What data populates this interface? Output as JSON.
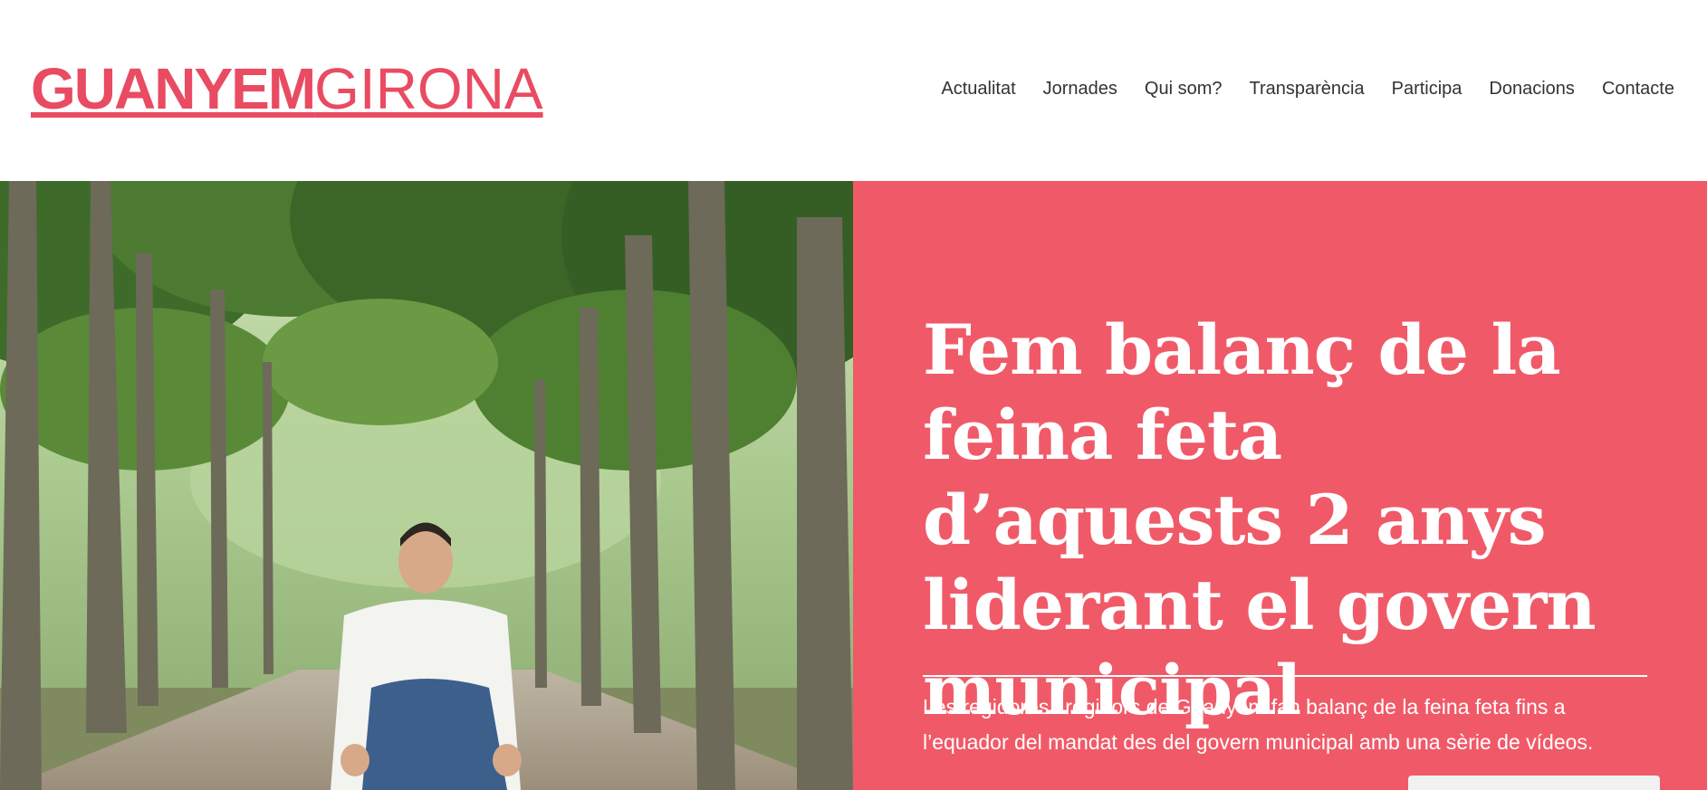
{
  "header": {
    "logo_bold": "GUANYEM",
    "logo_light": "GIRONA",
    "nav": [
      "Actualitat",
      "Jornades",
      "Qui som?",
      "Transparència",
      "Participa",
      "Donacions",
      "Contacte"
    ]
  },
  "hero": {
    "headline": "Fem balanç de la feina feta d’aquests 2 anys liderant el govern municipal",
    "subtitle": "Les regidores i regidors de Guanyem fan balanç de la feina feta fins a l’equador del mandat des del govern municipal amb una sèrie de vídeos."
  },
  "colors": {
    "brand": "#e94b62",
    "panel": "#f05a68",
    "nav_text": "#333333"
  }
}
